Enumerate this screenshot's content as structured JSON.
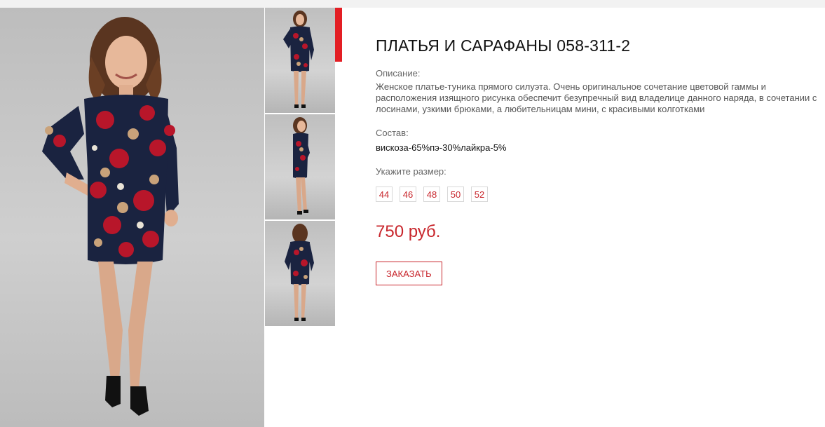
{
  "product": {
    "title": "ПЛАТЬЯ И САРАФАНЫ 058-311-2",
    "description_label": "Описание:",
    "description": "Женское платье-туника прямого силуэта. Очень оригинальное сочетание цветовой гаммы и расположения изящного рисунка обесп­ечит безупречный вид владелице данного наряда, в сочетании с лосинами, узкими брюками, а любительницам мини, с красивыми колготками",
    "composition_label": "Состав:",
    "composition": "вискоза-65%пэ-30%лайкра-5%",
    "size_label": "Укажите размер:",
    "sizes": [
      "44",
      "46",
      "48",
      "50",
      "52"
    ],
    "price": "750 руб.",
    "order_label": "ЗАКАЗАТЬ"
  },
  "colors": {
    "accent": "#e31e24",
    "price": "#c8262c",
    "dress": "#1a2340",
    "rose": "#b8162a"
  }
}
